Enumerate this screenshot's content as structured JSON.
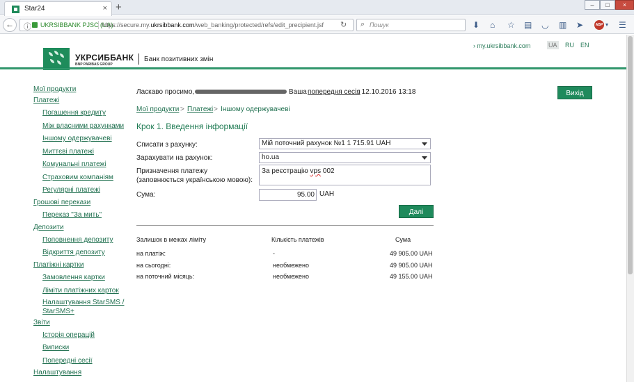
{
  "browser": {
    "tab_title": "Star24",
    "tab_close": "×",
    "new_tab": "+",
    "org": "UKRSIBBANK PJSC (UA)",
    "url_prefix": "https://secure.my.",
    "url_domain": "ukrsibbank.com",
    "url_path": "/web_banking/protected/refs/edit_precipient.jsf",
    "search_placeholder": "Пошук",
    "abp_label": "ABP",
    "window_buttons": [
      "–",
      "□",
      "×"
    ]
  },
  "header": {
    "site_link": "› my.ukrsibbank.com",
    "lang_ua": "UA",
    "lang_ru": "RU",
    "lang_en": "EN",
    "brand": "УКРСИББАНК",
    "brand_sub": "BNP PARIBAS GROUP",
    "slogan": "Банк позитивних змін",
    "brand_color": "#1f8a5c"
  },
  "sidebar": {
    "items": [
      {
        "label": "Мої продукти",
        "level": 0
      },
      {
        "label": "Платежі",
        "level": 0
      },
      {
        "label": "Погашення кредиту",
        "level": 1
      },
      {
        "label": "Між власними рахунками",
        "level": 1
      },
      {
        "label": "Іншому одержувачеві",
        "level": 1
      },
      {
        "label": "Миттєві платежі",
        "level": 1
      },
      {
        "label": "Комунальні платежі",
        "level": 1
      },
      {
        "label": "Страховим компаніям",
        "level": 1
      },
      {
        "label": "Регулярні платежі",
        "level": 1
      },
      {
        "label": "Грошові перекази",
        "level": 0
      },
      {
        "label": "Переказ \"За мить\"",
        "level": 1
      },
      {
        "label": "Депозити",
        "level": 0
      },
      {
        "label": "Поповнення депозиту",
        "level": 1
      },
      {
        "label": "Відкриття депозиту",
        "level": 1
      },
      {
        "label": "Платіжні картки",
        "level": 0
      },
      {
        "label": "Замовлення картки",
        "level": 1
      },
      {
        "label": "Ліміти платіжних карток",
        "level": 1
      },
      {
        "label": "Налаштування StarSMS /",
        "level": 1
      },
      {
        "label": "StarSMS+",
        "level": 1
      },
      {
        "label": "Звіти",
        "level": 0
      },
      {
        "label": "Історія операцій",
        "level": 1
      },
      {
        "label": "Виписки",
        "level": 1
      },
      {
        "label": "Попередні сесії",
        "level": 1
      },
      {
        "label": "Налаштування",
        "level": 0
      }
    ]
  },
  "main": {
    "welcome_prefix": "Ласкаво просимо,",
    "welcome_suffix": "Ваша",
    "prev_session_link": "попередня сесія",
    "prev_session_time": ": 12.10.2016 13:18",
    "exit_label": "Вихід",
    "breadcrumb": [
      "Мої продукти",
      "Платежі",
      "Іншому одержувачеві"
    ],
    "breadcrumb_sep": ">",
    "step_title": "Крок 1. Введення інформації",
    "debit_label": "Списати з рахунку:",
    "debit_value": "Мій поточний рахунок №1   1 715.91 UAH",
    "credit_label": "Зарахувати на рахунок:",
    "credit_value": "ho.ua",
    "purpose_label_1": "Призначення платежу",
    "purpose_label_2": "(заповнюється українською мовою):",
    "purpose_value_a": "За реєстрацію ",
    "purpose_value_b": "vps",
    "purpose_value_c": " 002",
    "amount_label": "Сума:",
    "amount_value": "95.00",
    "currency": "UAH",
    "next_label": "Далі"
  },
  "limits": {
    "headers": [
      "Залишок в межах ліміту",
      "Кількість платежів",
      "Сума"
    ],
    "rows": [
      {
        "label": "на платіж:",
        "count": "-",
        "sum": "49 905.00 UAH"
      },
      {
        "label": "на сьогодні:",
        "count": "необмежено",
        "sum": "49 905.00 UAH"
      },
      {
        "label": "на поточний місяць:",
        "count": "необмежено",
        "sum": "49 155.00 UAH"
      }
    ]
  }
}
